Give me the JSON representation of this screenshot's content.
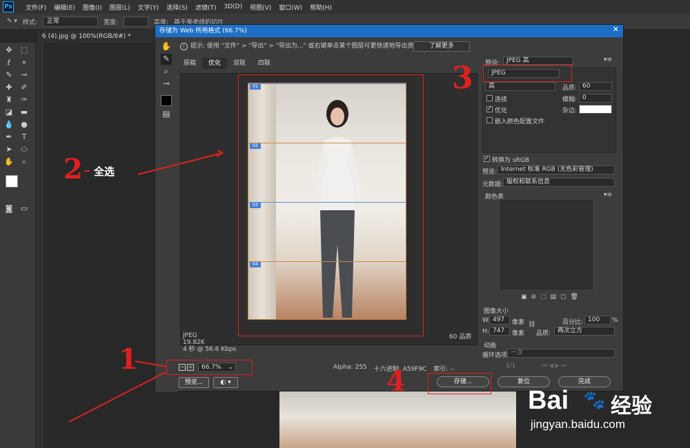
{
  "app": {
    "logo": "Ps",
    "menu": [
      "文件(F)",
      "编辑(E)",
      "图像(I)",
      "图层(L)",
      "文字(Y)",
      "选择(S)",
      "滤镜(T)",
      "3D(D)",
      "视图(V)",
      "窗口(W)",
      "帮助(H)"
    ]
  },
  "options": {
    "style_label": "样式:",
    "style_value": "正常",
    "width_label": "宽度:",
    "height_label": "高度:",
    "snap_label": "基于参考线的切片"
  },
  "doc_tab": "6 (4).jpg @ 100%(RGB/8#) *",
  "dialog": {
    "title": "存储为 Web 所用格式 (66.7%)",
    "hint": "提示: 使用 \"文件\" > \"导出\" > \"导出为...\" 或右键单击某个图层可更快速地导出资源",
    "learn_more": "了解更多",
    "tabs": [
      "原稿",
      "优化",
      "双联",
      "四联"
    ],
    "slices": [
      "01",
      "02",
      "03",
      "04"
    ],
    "file_info": [
      "JPEG",
      "19.82K",
      "4 秒 @ 56.6 Kbps"
    ],
    "quality_label": "60 品质",
    "zoom": "66.7%",
    "status": {
      "alpha": "Alpha: 255",
      "hex": "十六进制: A59F9C",
      "index": "索引: --"
    },
    "buttons": {
      "preview": "预览...",
      "save": "存储...",
      "reset": "复位",
      "done": "完成"
    },
    "right": {
      "preset_label": "预设:",
      "preset_value": "JPEG 高",
      "format": "JPEG",
      "quality_level": "高",
      "quality_label": "品质:",
      "quality_value": "60",
      "progressive": "连续",
      "blur_label": "模糊:",
      "blur_value": "0",
      "optimized": "优化",
      "matte_label": "杂边:",
      "embed_profile": "嵌入颜色配置文件",
      "convert_srgb": "转换为 sRGB",
      "preview_label": "预览:",
      "preview_value": "Internet 标准 RGB (无色彩管理)",
      "metadata_label": "元数据:",
      "metadata_value": "版权和联系信息",
      "color_table": "颜色表",
      "image_size": "图像大小",
      "w_label": "W:",
      "w_value": "497",
      "h_label": "H:",
      "h_value": "747",
      "px": "像素",
      "percent_label": "百分比:",
      "percent_value": "100",
      "pct": "%",
      "quality2_label": "品质:",
      "quality2_value": "两次立方",
      "anim": "动画",
      "loop_label": "循环选项:",
      "loop_value": "一次",
      "frame": "1/1"
    }
  },
  "annotations": {
    "n1": "1",
    "n2": "2",
    "n3": "3",
    "n4": "4",
    "select_all": "全选"
  },
  "watermark": {
    "brand": "Bai",
    "brand2": "经验",
    "url": "jingyan.baidu.com"
  },
  "colors": {
    "accent": "#1e6fc4",
    "annot": "#e02020"
  }
}
